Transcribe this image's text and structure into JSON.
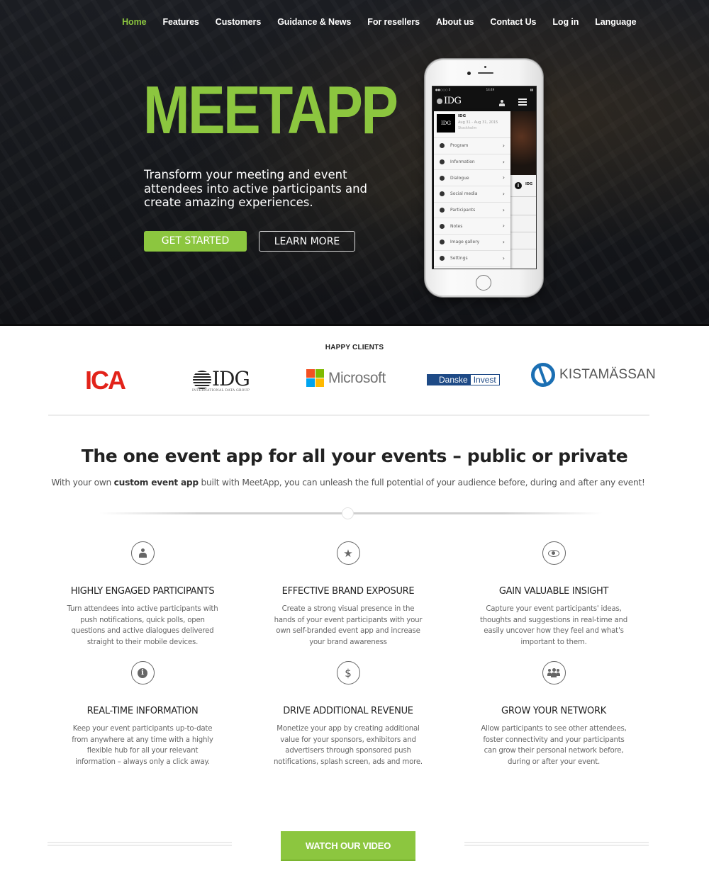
{
  "nav": {
    "items": [
      {
        "label": "Home",
        "active": true
      },
      {
        "label": "Features",
        "active": false
      },
      {
        "label": "Customers",
        "active": false
      },
      {
        "label": "Guidance & News",
        "active": false
      },
      {
        "label": "For resellers",
        "active": false
      },
      {
        "label": "About us",
        "active": false
      },
      {
        "label": "Contact Us",
        "active": false
      },
      {
        "label": "Log in",
        "active": false
      },
      {
        "label": "Language",
        "active": false
      }
    ]
  },
  "hero": {
    "brand": "MEETAPP",
    "tagline": "Transform your meeting and event attendees into active participants and create amazing experiences.",
    "get_started_label": "GET STARTED",
    "learn_more_label": "LEARN MORE",
    "accent_color": "#8cc63f"
  },
  "phone": {
    "status_left": "●●○○○ 3 ",
    "status_time": "14:49",
    "status_right": "▮▮",
    "app_logo": "IDG",
    "event": {
      "name": "IDG",
      "dates": "Aug 31 - Aug 31, 2015",
      "location": "Stockholm",
      "thumb": "IDG"
    },
    "menu": [
      {
        "label": "Program",
        "icon": "clock-icon"
      },
      {
        "label": "Information",
        "icon": "info-icon"
      },
      {
        "label": "Dialogue",
        "icon": "chat-icon"
      },
      {
        "label": "Social media",
        "icon": "twitter-icon"
      },
      {
        "label": "Participants",
        "icon": "group-icon"
      },
      {
        "label": "Notes",
        "icon": "edit-icon"
      },
      {
        "label": "Image gallery",
        "icon": "image-icon"
      },
      {
        "label": "Settings",
        "icon": "gear-icon"
      }
    ],
    "right_pane_label": "IDG"
  },
  "clients": {
    "title": "HAPPY CLIENTS",
    "logos": {
      "ica": "ICA",
      "idg": "IDG",
      "idg_sub": "INTERNATIONAL DATA GROUP",
      "microsoft": "Microsoft",
      "danske_a": "Danske",
      "danske_b": "Invest",
      "kista": "KISTAMÄSSAN"
    }
  },
  "intro": {
    "headline": "The one event app for all your events – public or private",
    "lead_before": "With your own ",
    "lead_bold": "custom event app",
    "lead_after": " built with MeetApp, you can unleash the full potential of your audience before, during and after any event!"
  },
  "features": [
    {
      "icon": "user-icon",
      "title": "HIGHLY ENGAGED PARTICIPANTS",
      "text": "Turn attendees into active participants with push notifications, quick polls, open questions and active dialogues delivered straight to their mobile devices."
    },
    {
      "icon": "star-icon",
      "title": "EFFECTIVE BRAND EXPOSURE",
      "text": "Create a strong visual presence in the hands of your event participants with your own self-branded event app and increase your brand awareness"
    },
    {
      "icon": "eye-icon",
      "title": "GAIN VALUABLE INSIGHT",
      "text": "Capture your event participants' ideas, thoughts and suggestions in real-time and easily uncover how they feel and what's important to them."
    },
    {
      "icon": "info-icon",
      "title": "REAL-TIME INFORMATION",
      "text": "Keep your event participants up-to-date from anywhere at any time with a highly flexible hub for all your relevant information – always only a click away."
    },
    {
      "icon": "dollar-icon",
      "title": "DRIVE ADDITIONAL REVENUE",
      "text": "Monetize your app by creating additional value for your sponsors, exhibitors and advertisers through sponsored push notifications, splash screen, ads and more."
    },
    {
      "icon": "group-icon",
      "title": "GROW YOUR NETWORK",
      "text": "Allow participants to see other attendees, foster connectivity and your participants can grow their personal network before, during or after your event."
    }
  ],
  "cta": {
    "watch_video_label": "WATCH OUR VIDEO"
  }
}
